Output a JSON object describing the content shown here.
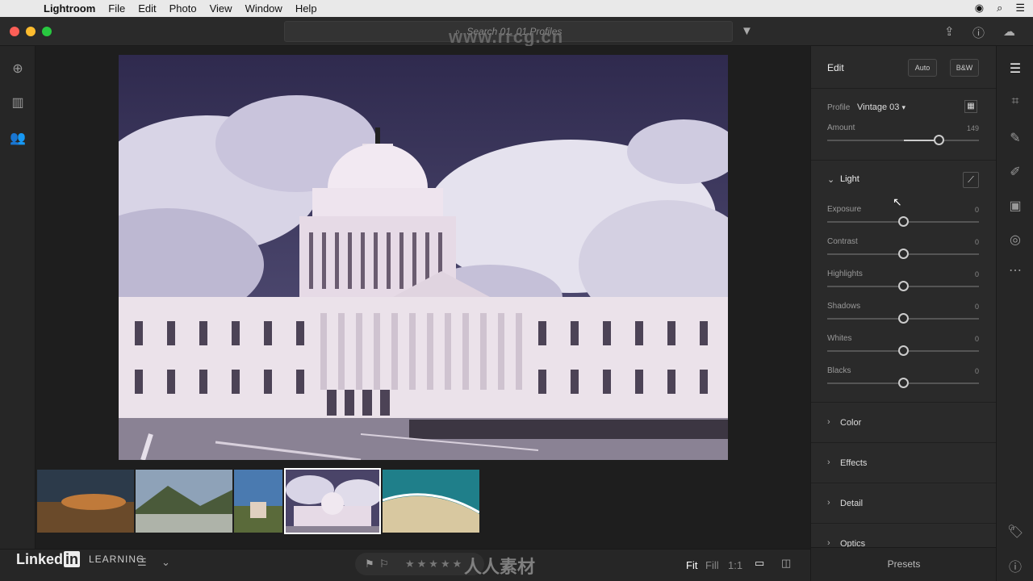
{
  "menubar": {
    "app": "Lightroom",
    "items": [
      "File",
      "Edit",
      "Photo",
      "View",
      "Window",
      "Help"
    ]
  },
  "search": {
    "placeholder": "Search 01_01 Profiles"
  },
  "watermark": "www.rrcg.cn",
  "edit": {
    "title": "Edit",
    "auto": "Auto",
    "bw": "B&W",
    "profile_label": "Profile",
    "profile_value": "Vintage 03",
    "amount_label": "Amount",
    "amount_value": "149"
  },
  "light": {
    "title": "Light",
    "sliders": [
      {
        "label": "Exposure",
        "value": "0"
      },
      {
        "label": "Contrast",
        "value": "0"
      },
      {
        "label": "Highlights",
        "value": "0"
      },
      {
        "label": "Shadows",
        "value": "0"
      },
      {
        "label": "Whites",
        "value": "0"
      },
      {
        "label": "Blacks",
        "value": "0"
      }
    ]
  },
  "sections": [
    "Color",
    "Effects",
    "Detail",
    "Optics"
  ],
  "bottom": {
    "logo": "Linked",
    "logo_in": "in",
    "learning": "LEARNING",
    "fit": "Fit",
    "fill": "Fill",
    "ratio": "1:1",
    "presets": "Presets",
    "stars": "★★★★★",
    "bottom_watermark": "人人素材"
  },
  "colors": {
    "accent": "#4a90d9",
    "panel_bg": "#2a2a2a",
    "sky": "#3b3458"
  }
}
